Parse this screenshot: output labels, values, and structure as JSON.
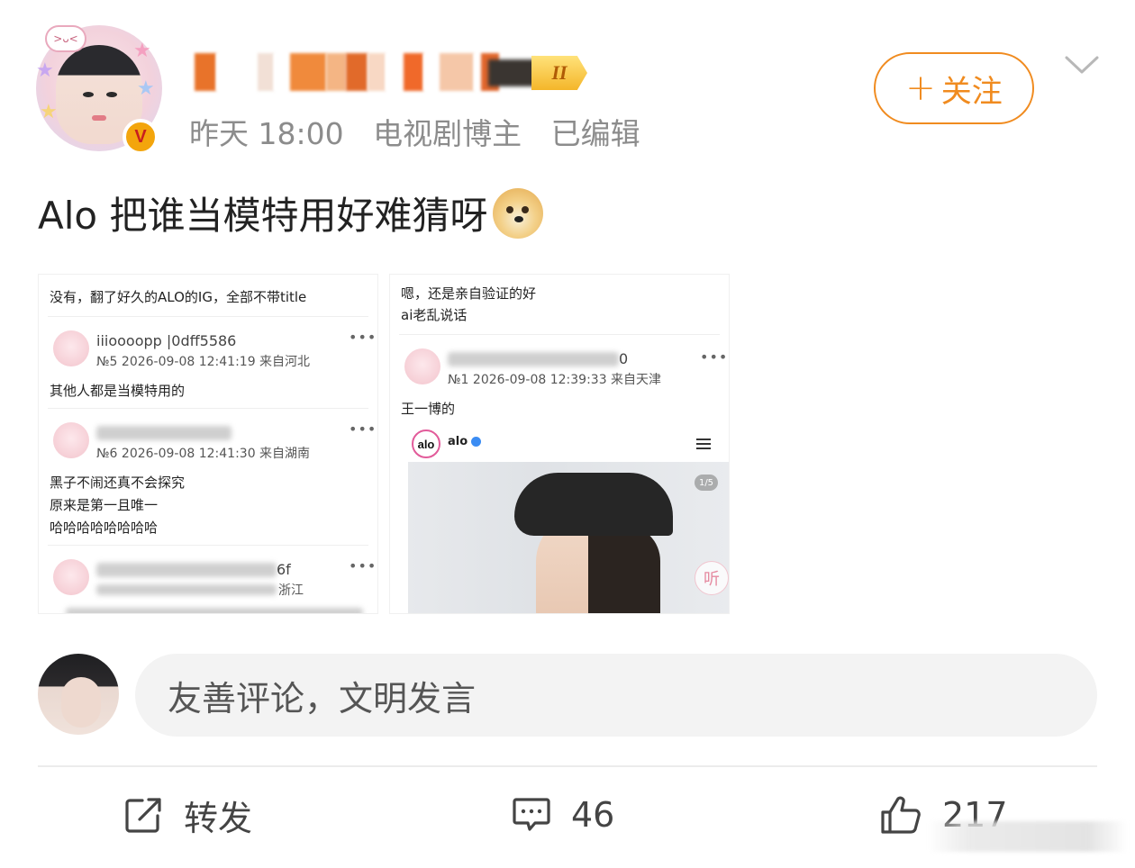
{
  "header": {
    "meta": [
      "昨天 18:00",
      "电视剧博主",
      "已编辑"
    ],
    "level": "II",
    "verified_badge": "V",
    "follow_label": "+ 关注",
    "follow_plus": "+",
    "follow_text": "关注",
    "accent_color": "#f08b1f"
  },
  "post": {
    "text": "Alo 把谁当模特用好难猜呀",
    "emoji": "doge-emoji"
  },
  "images": [
    {
      "header_text": "没有，翻了好久的ALO的IG，全部不带title",
      "comments": [
        {
          "user": "iiioooopp |0dff5586",
          "meta": "№5 2026-09-08 12:41:19 来自河北",
          "body": [
            "其他人都是当模特用的"
          ]
        },
        {
          "user": "",
          "meta": "№6 2026-09-08 12:41:30 来自湖南",
          "body": [
            "黑子不闹还真不会探究",
            "原来是第一且唯一",
            "哈哈哈哈哈哈哈哈"
          ]
        },
        {
          "user": "6f",
          "meta": "浙江",
          "body": []
        }
      ]
    },
    {
      "header_lines": [
        "嗯，还是亲自验证的好",
        "ai老乱说话"
      ],
      "comments": [
        {
          "user": "0",
          "meta": "№1 2026-09-08 12:39:33 来自天津",
          "body": [
            "王一博的"
          ]
        }
      ],
      "brand_logo": "alo",
      "brand_name": "alo",
      "pager": "1/5",
      "listen": "听"
    }
  ],
  "comment_box": {
    "placeholder": "友善评论，文明发言"
  },
  "actions": {
    "repost_label": "转发",
    "comment_count": "46",
    "like_count": "217"
  },
  "icons": {
    "repost": "share-icon",
    "comment": "comment-icon",
    "like": "thumbs-up-icon",
    "collapse": "chevron-down-icon"
  }
}
